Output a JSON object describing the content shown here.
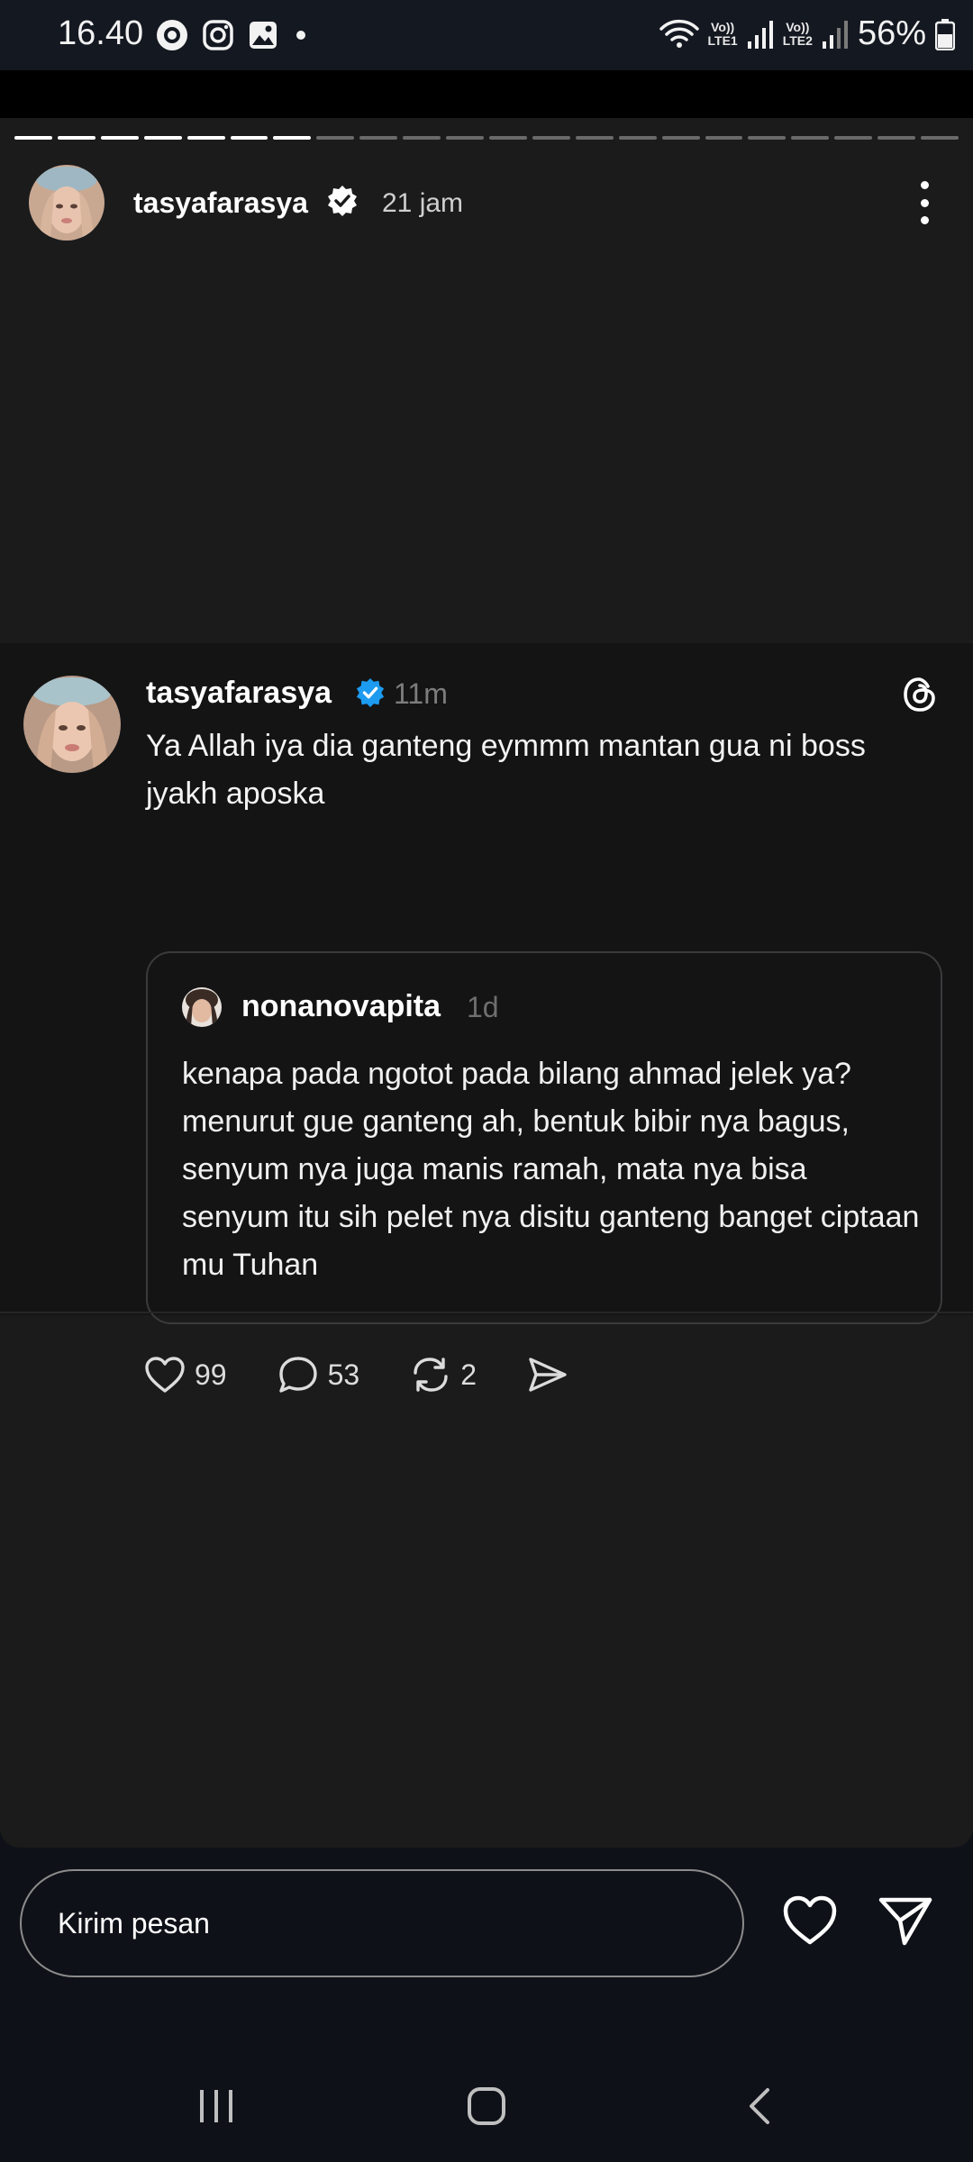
{
  "status_bar": {
    "time": "16.40",
    "battery": "56%",
    "sim1": {
      "top": "Vo))",
      "bottom": "LTE1"
    },
    "sim2": {
      "top": "Vo))",
      "bottom": "LTE2"
    },
    "icons": [
      "threads-notification-icon",
      "instagram-icon",
      "gallery-icon",
      "dot-icon",
      "wifi-icon",
      "signal-icon",
      "battery-icon"
    ]
  },
  "story": {
    "progress": {
      "total_segments": 22,
      "completed_segments": 7
    },
    "username": "tasyafarasya",
    "time": "21 jam"
  },
  "post": {
    "username": "tasyafarasya",
    "time": "11m",
    "text": "Ya Allah iya dia ganteng eymmm mantan gua ni boss jyakh aposka",
    "quoted": {
      "username": "nonanovapita",
      "time": "1d",
      "text": "kenapa pada ngotot pada bilang ahmad jelek ya? menurut gue ganteng ah, bentuk bibir nya bagus, senyum nya juga manis ramah, mata nya bisa senyum itu sih pelet nya disitu ganteng banget ciptaan mu Tuhan"
    },
    "likes": "99",
    "comments": "53",
    "reposts": "2"
  },
  "reply": {
    "placeholder": "Kirim pesan"
  },
  "colors": {
    "verified_blue": "#1d9bf0",
    "background": "#0e1117",
    "story_bg": "#1b1b1c",
    "post_bg": "#141415"
  }
}
